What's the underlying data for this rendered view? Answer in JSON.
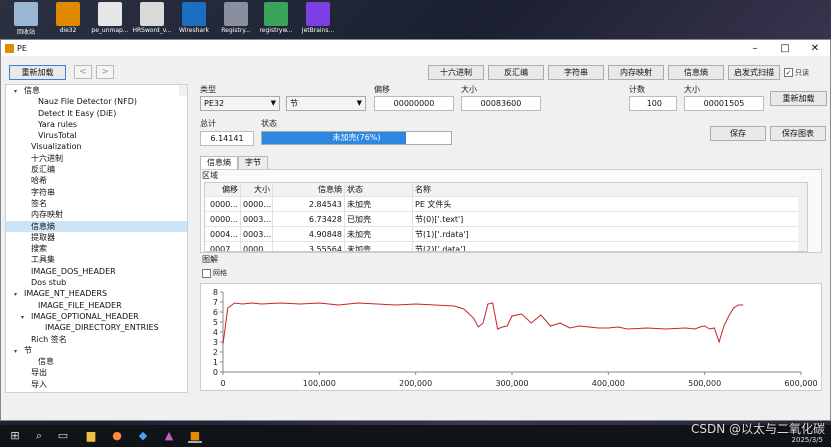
{
  "desktop_icons": [
    {
      "label": "回收站",
      "icon": "recycle-bin-icon",
      "color": "#9bb7d4"
    },
    {
      "label": "die32",
      "icon": "die-icon",
      "color": "#e08a00"
    },
    {
      "label": "pe_unmap...",
      "icon": "pe-icon",
      "color": "#e6e6e6"
    },
    {
      "label": "HRSword_v...",
      "icon": "hrsword-icon",
      "color": "#d9d9d9"
    },
    {
      "label": "Wireshark",
      "icon": "wireshark-icon",
      "color": "#1a6fc1"
    },
    {
      "label": "Registry...",
      "icon": "registry-icon",
      "color": "#8a8fa0"
    },
    {
      "label": "registryw...",
      "icon": "registry-icon",
      "color": "#3aa35a"
    },
    {
      "label": "JetBrains...",
      "icon": "jetbrains-icon",
      "color": "#7b3fe4"
    }
  ],
  "window": {
    "title": "PE",
    "min": "–",
    "max": "□",
    "close": "✕"
  },
  "toolbar": {
    "reload": "重新加载",
    "back": "<",
    "forward": ">"
  },
  "tabs": [
    "十六进制",
    "反汇编",
    "字符串",
    "内存映射",
    "信息熵",
    "启发式扫描"
  ],
  "readonly_label": "只读",
  "tree": [
    {
      "label": "信息",
      "indent": 0,
      "arrow": "▾"
    },
    {
      "label": "Nauz File Detector (NFD)",
      "indent": 2,
      "arrow": ""
    },
    {
      "label": "Detect It Easy (DiE)",
      "indent": 2,
      "arrow": ""
    },
    {
      "label": "Yara rules",
      "indent": 2,
      "arrow": ""
    },
    {
      "label": "VirusTotal",
      "indent": 2,
      "arrow": ""
    },
    {
      "label": "Visualization",
      "indent": 1,
      "arrow": ""
    },
    {
      "label": "十六进制",
      "indent": 1,
      "arrow": ""
    },
    {
      "label": "反汇编",
      "indent": 1,
      "arrow": ""
    },
    {
      "label": "哈希",
      "indent": 1,
      "arrow": ""
    },
    {
      "label": "字符串",
      "indent": 1,
      "arrow": ""
    },
    {
      "label": "签名",
      "indent": 1,
      "arrow": ""
    },
    {
      "label": "内存映射",
      "indent": 1,
      "arrow": ""
    },
    {
      "label": "信息熵",
      "indent": 1,
      "arrow": "",
      "selected": true
    },
    {
      "label": "提取器",
      "indent": 1,
      "arrow": ""
    },
    {
      "label": "搜索",
      "indent": 1,
      "arrow": ""
    },
    {
      "label": "工具集",
      "indent": 1,
      "arrow": ""
    },
    {
      "label": "IMAGE_DOS_HEADER",
      "indent": 1,
      "arrow": ""
    },
    {
      "label": "Dos stub",
      "indent": 1,
      "arrow": ""
    },
    {
      "label": "IMAGE_NT_HEADERS",
      "indent": 0,
      "arrow": "▾"
    },
    {
      "label": "IMAGE_FILE_HEADER",
      "indent": 2,
      "arrow": ""
    },
    {
      "label": "IMAGE_OPTIONAL_HEADER",
      "indent": 1,
      "arrow": "▾"
    },
    {
      "label": "IMAGE_DIRECTORY_ENTRIES",
      "indent": 3,
      "arrow": ""
    },
    {
      "label": "Rich 签名",
      "indent": 1,
      "arrow": ""
    },
    {
      "label": "节",
      "indent": 0,
      "arrow": "▾"
    },
    {
      "label": "信息",
      "indent": 2,
      "arrow": ""
    },
    {
      "label": "导出",
      "indent": 1,
      "arrow": ""
    },
    {
      "label": "导入",
      "indent": 1,
      "arrow": ""
    }
  ],
  "form": {
    "type_label": "类型",
    "type_value": "PE32",
    "section_value": "节",
    "offset_label": "偏移",
    "offset_value": "00000000",
    "size_label": "大小",
    "size_value": "00083600",
    "count_label": "计数",
    "count_value": "100",
    "size2_label": "大小",
    "size2_value": "00001505",
    "reload2": "重新加载",
    "total_label": "总计",
    "total_value": "6.14141",
    "status_label": "状态",
    "status_text": "未加壳(76%)",
    "status_percent": 76,
    "save": "保存",
    "save_chart": "保存图表"
  },
  "subtabs": [
    "信息熵",
    "字节"
  ],
  "region_label": "区域",
  "table": {
    "headers": [
      "偏移",
      "大小",
      "信息熵",
      "状态",
      "名称"
    ],
    "rows": [
      [
        "0000...",
        "0000...",
        "2.84543",
        "未加壳",
        "PE 文件头"
      ],
      [
        "0000...",
        "0003...",
        "6.73428",
        "已加壳",
        "节(0)['.text']"
      ],
      [
        "0004...",
        "0003...",
        "4.90848",
        "未加壳",
        "节(1)['.rdata']"
      ],
      [
        "0007...",
        "0000...",
        "3.55564",
        "未加壳",
        "节(2)['.data']"
      ]
    ]
  },
  "chart_label": "图解",
  "grid_label": "网格",
  "chart_data": {
    "type": "line",
    "title": "",
    "xlabel": "",
    "ylabel": "",
    "xlim": [
      0,
      600000
    ],
    "ylim": [
      0,
      8
    ],
    "x_ticks": [
      "0",
      "100,000",
      "200,000",
      "300,000",
      "400,000",
      "500,000",
      "600,000"
    ],
    "y_ticks": [
      "0",
      "1",
      "2",
      "3",
      "4",
      "5",
      "6",
      "7",
      "8"
    ],
    "grid": false,
    "series": [
      {
        "color": "#cc2222",
        "x": [
          0,
          5000,
          12000,
          20000,
          30000,
          40000,
          60000,
          80000,
          100000,
          120000,
          140000,
          160000,
          180000,
          200000,
          220000,
          240000,
          250000,
          260000,
          265000,
          270000,
          275000,
          280000,
          285000,
          290000,
          295000,
          300000,
          310000,
          320000,
          330000,
          340000,
          350000,
          360000,
          370000,
          380000,
          390000,
          400000,
          410000,
          420000,
          440000,
          460000,
          480000,
          490000,
          495000,
          500000,
          505000,
          510000,
          515000,
          520000,
          525000,
          530000,
          535000,
          540000
        ],
        "y": [
          2.8,
          6.4,
          6.9,
          6.8,
          6.9,
          6.8,
          6.9,
          6.8,
          6.9,
          6.7,
          6.9,
          6.8,
          6.7,
          6.8,
          6.7,
          6.6,
          6.3,
          5.4,
          4.5,
          4.9,
          6.8,
          6.9,
          4.3,
          4.5,
          4.6,
          5.6,
          5.8,
          4.9,
          5.7,
          4.6,
          4.9,
          4.4,
          4.6,
          4.5,
          4.4,
          4.4,
          4.5,
          4.3,
          4.4,
          4.3,
          4.4,
          4.3,
          4.5,
          4.6,
          4.3,
          4.4,
          3.0,
          4.6,
          5.6,
          6.4,
          6.7,
          6.7
        ]
      }
    ]
  },
  "taskbar": {
    "watermark": "CSDN @以太与二氧化碳",
    "time": "2025/3/5"
  }
}
